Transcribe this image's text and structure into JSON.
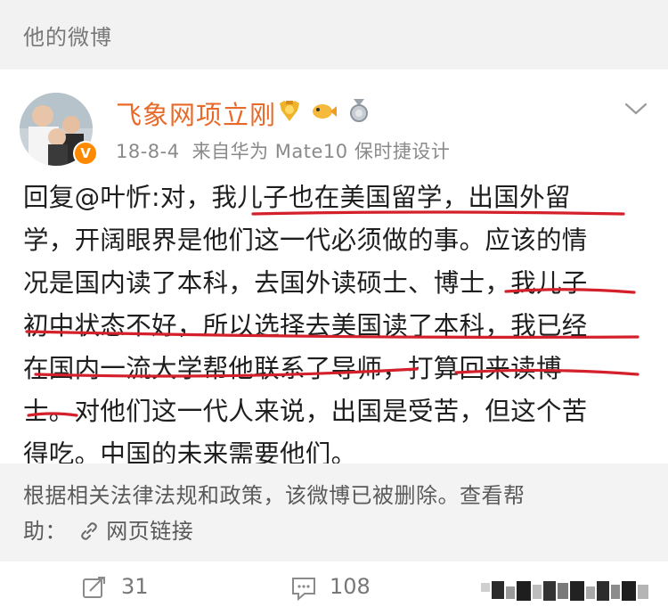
{
  "page": {
    "title": "他的微博"
  },
  "post": {
    "author": {
      "name": "飞象网项立刚",
      "verified_mark": "V"
    },
    "meta": {
      "date": "18-8-4",
      "source": "来自华为 Mate10 保时捷设计"
    },
    "body_lines": [
      "回复@叶忻:对，我儿子也在美国留学，出国外留",
      "学，开阔眼界是他们这一代必须做的事。应该的情",
      "况是国内读了本科，去国外读硕士、博士，我儿子",
      "初中状态不好，所以选择去美国读了本科，我已经",
      "在国内一流大学帮他联系了导师，打算回来读博",
      "士。对他们这一代人来说，出国是受苦，但这个苦",
      "得吃。中国的未来需要他们。"
    ],
    "deleted_notice": {
      "line1": "根据相关法律法规和政策，该微博已被删除。查看帮",
      "line2_prefix": "助：",
      "link_label": "网页链接"
    }
  },
  "actions": {
    "repost_count": "31",
    "comment_count": "108"
  },
  "colors": {
    "username": "#e86a2a",
    "underline": "#d4202a",
    "top_bar": "#f2f2f2",
    "deleted_bg": "#f3f3f3",
    "verified": "#ff8a00"
  },
  "icons": [
    "gold-badge-icon",
    "fish-badge-icon",
    "medal-badge-icon",
    "chevron-down-icon",
    "link-icon",
    "repost-icon",
    "comment-icon"
  ]
}
